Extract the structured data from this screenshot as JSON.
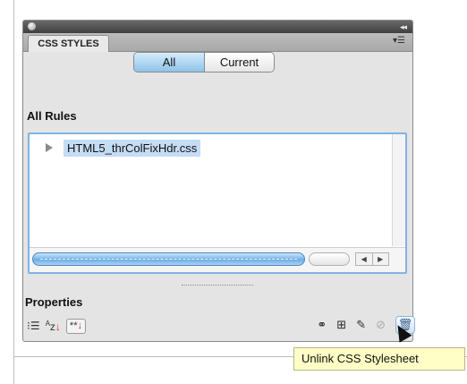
{
  "panel": {
    "tab_label": "CSS STYLES",
    "collapse_icon": "double-chevron-right",
    "menu_icon": "panel-menu-lines"
  },
  "mode_toggle": {
    "all_label": "All",
    "current_label": "Current",
    "selected": "All"
  },
  "rules_section": {
    "label": "All Rules",
    "items": [
      {
        "label": "HTML5_thrColFixHdr.css",
        "selected": true,
        "expanded": false
      }
    ]
  },
  "properties_section": {
    "label": "Properties",
    "left_tools": [
      "show-category-view-icon",
      "show-alphabetical-view-icon",
      "show-set-properties-icon"
    ],
    "right_tools": [
      "attach-style-sheet-icon",
      "new-css-rule-icon",
      "edit-style-icon",
      "disable-enable-icon",
      "unlink-delete-icon"
    ]
  },
  "tooltip": {
    "text": "Unlink CSS Stylesheet"
  },
  "colors": {
    "selection": "#c5dcf5",
    "accent": "#7fb3e3",
    "tooltip_bg": "#fefec6"
  }
}
